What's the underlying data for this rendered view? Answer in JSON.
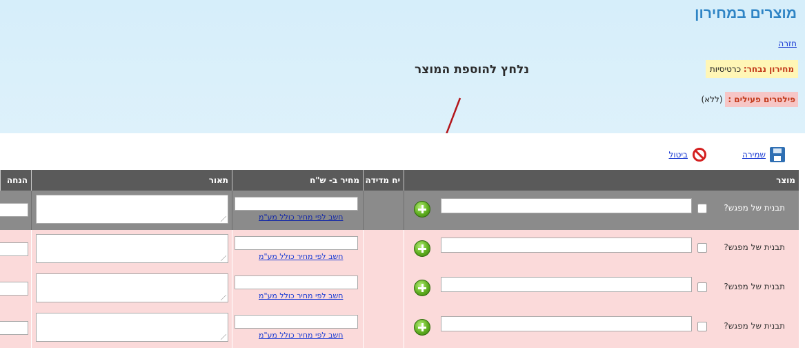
{
  "page": {
    "title": "מוצרים במחירון",
    "back_label": "חזרה",
    "selected_price_label": "מחירון נבחר:",
    "selected_price_value": "כרטיסיות",
    "filters_label": "פילטרים פעילים :",
    "filters_value": "(ללא)",
    "annotation": "נלחץ להוספת המוצר"
  },
  "toolbar": {
    "save_label": "שמירה",
    "cancel_label": "ביטול",
    "save_icon": "floppy-disk-icon",
    "cancel_icon": "no-entry-icon"
  },
  "table": {
    "columns": [
      "מוצר",
      "יח מדידה",
      "מחיר ב- ש\"ח",
      "תאור",
      "הנחה"
    ],
    "rows": [
      {
        "product_label": "תבנית של מפגש?",
        "calc_link": "חשב לפי מחיר כולל מע\"מ",
        "selected": true
      },
      {
        "product_label": "תבנית של מפגש?",
        "calc_link": "חשב לפי מחיר כולל מע\"מ",
        "selected": false
      },
      {
        "product_label": "תבנית של מפגש?",
        "calc_link": "חשב לפי מחיר כולל מע\"מ",
        "selected": false
      },
      {
        "product_label": "תבנית של מפגש?",
        "calc_link": "חשב לפי מחיר כולל מע\"מ",
        "selected": false
      }
    ]
  },
  "colors": {
    "title": "#2e84c5",
    "header_bg": "#5a5a5a",
    "row_bg": "#fbdada",
    "selected_row_bg": "#8b8b8b",
    "arrow": "#b3161b",
    "plus_icon": "#5fae1f"
  }
}
